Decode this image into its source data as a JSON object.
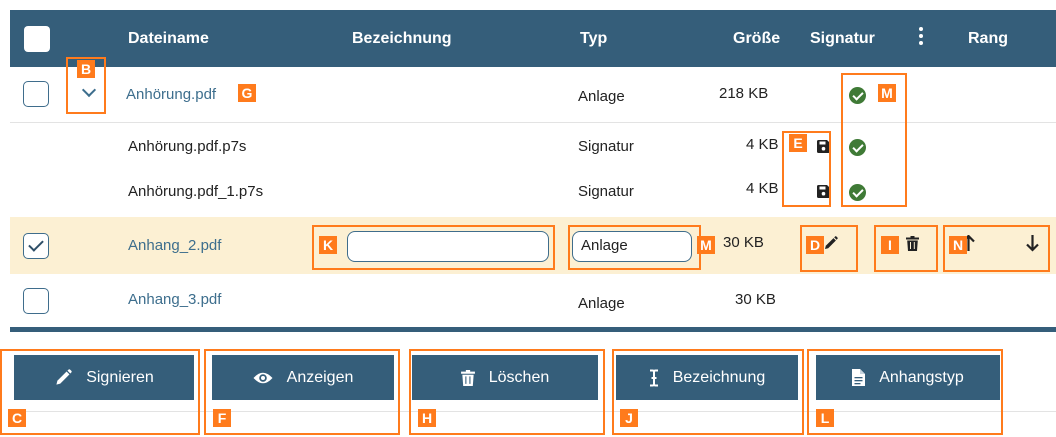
{
  "columns": {
    "dateiname": "Dateiname",
    "bezeichnung": "Bezeichnung",
    "typ": "Typ",
    "groesse": "Größe",
    "signatur": "Signatur",
    "rang": "Rang"
  },
  "rows": [
    {
      "name": "Anhörung.pdf",
      "typ": "Anlage",
      "groesse": "218 KB"
    },
    {
      "name": "Anhörung.pdf.p7s",
      "typ": "Signatur",
      "groesse": "4 KB"
    },
    {
      "name": "Anhörung.pdf_1.p7s",
      "typ": "Signatur",
      "groesse": "4 KB"
    },
    {
      "name": "Anhang_2.pdf",
      "bezeichnung": "",
      "typ": "Anlage",
      "groesse": "30 KB"
    },
    {
      "name": "Anhang_3.pdf",
      "typ": "Anlage",
      "groesse": "30 KB"
    }
  ],
  "buttons": {
    "signieren": "Signieren",
    "anzeigen": "Anzeigen",
    "loeschen": "Löschen",
    "bezeichnung": "Bezeichnung",
    "anhangstyp": "Anhangstyp"
  },
  "markers": {
    "b": "B",
    "g": "G",
    "m1": "M",
    "e": "E",
    "k": "K",
    "m2": "M",
    "d": "D",
    "i": "I",
    "n": "N",
    "c": "C",
    "f": "F",
    "h": "H",
    "j": "J",
    "l": "L"
  },
  "icons": [
    "check-all-icon",
    "chevron-down-icon",
    "signature-valid-icon",
    "save-icon",
    "pencil-icon",
    "trash-icon",
    "arrow-up-icon",
    "arrow-down-icon",
    "eye-icon",
    "text-cursor-icon",
    "file-icon",
    "column-menu-icon"
  ],
  "colors": {
    "header": "#355e7a",
    "selected_row": "#fcf0d3",
    "marker": "#ff7b1c",
    "check_green": "#3f7a36",
    "link": "#3d6e8d"
  }
}
